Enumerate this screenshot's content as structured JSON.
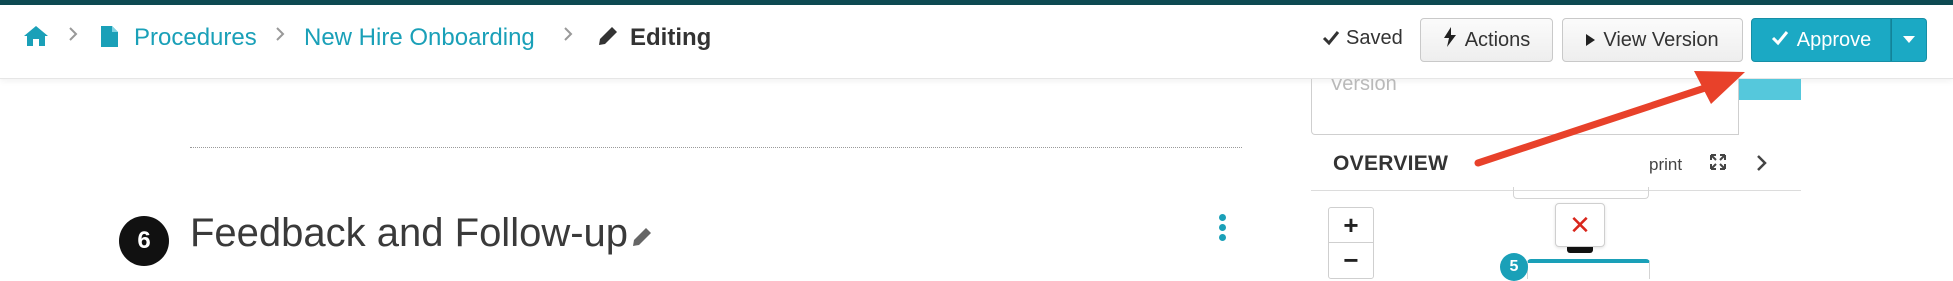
{
  "header": {
    "breadcrumb": [
      {
        "label": "Procedures"
      },
      {
        "label": "New Hire Onboarding"
      },
      {
        "label": "Editing"
      }
    ],
    "saved_label": "Saved",
    "actions_label": "Actions",
    "view_version_label": "View Version",
    "approve_label": "Approve"
  },
  "panel": {
    "input_value": "Version",
    "overview_title": "OVERVIEW",
    "print_label": "print",
    "zoom_in_label": "+",
    "zoom_out_label": "−",
    "delete_label": "✕",
    "node_number": "5"
  },
  "step": {
    "number": "6",
    "title": "Feedback and Follow-up"
  },
  "colors": {
    "accent": "#1aa0b8",
    "approve": "#1ba9c4",
    "annotation_arrow": "#e8412a",
    "delete": "#d9261c",
    "top_bar": "#0e4a52"
  },
  "icons": {
    "home": "home-icon",
    "document": "document-icon",
    "pencil": "pencil-icon",
    "check": "check-icon",
    "bolt": "bolt-icon",
    "play": "play-icon",
    "caret": "caret-down-icon",
    "expand": "expand-icon",
    "chevron": "chevron-right-icon",
    "kebab": "kebab-menu-icon"
  }
}
